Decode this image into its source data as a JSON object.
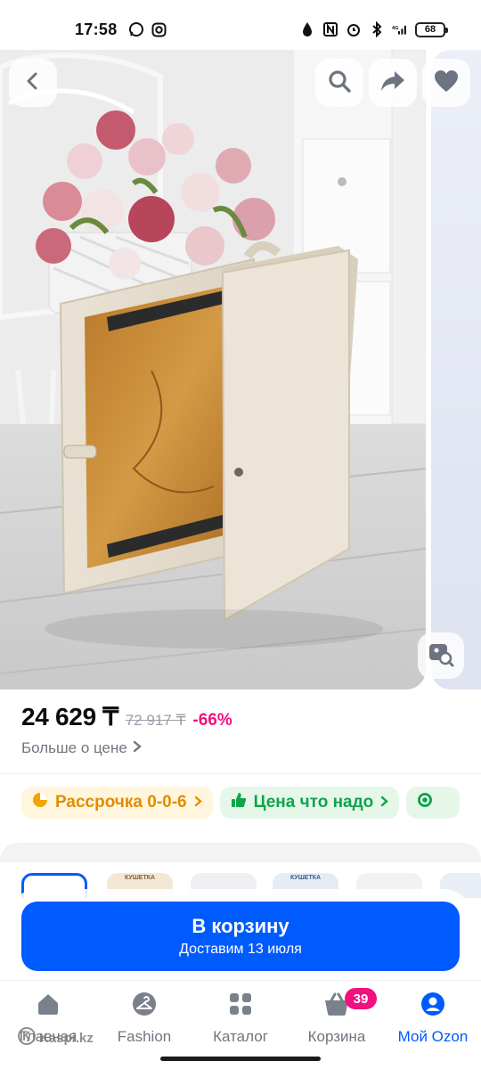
{
  "status_bar": {
    "time": "17:58",
    "battery": "68"
  },
  "gallery": {
    "back_icon": "chevron-left-icon",
    "search_icon": "search-icon",
    "share_icon": "share-arrow-icon",
    "favorite_icon": "heart-icon",
    "lens_icon": "image-search-icon"
  },
  "price": {
    "current": "24 629 ₸",
    "old": "72 917 ₸",
    "discount": "-66%",
    "more_label": "Больше о цене"
  },
  "chips": [
    {
      "label": "Рассрочка 0-0-6",
      "icon": "pie-icon"
    },
    {
      "label": "Цена что надо",
      "icon": "thumbs-up-icon"
    },
    {
      "label": "",
      "icon": "ruble-circle-icon"
    }
  ],
  "thumbnails": [
    {
      "label": ""
    },
    {
      "label": "КУШЕТКА"
    },
    {
      "label": ""
    },
    {
      "label": "КУШЕТКА"
    },
    {
      "label": ""
    },
    {
      "label": ""
    }
  ],
  "cart": {
    "title": "В корзину",
    "subtitle": "Доставим 13 июля"
  },
  "nav": {
    "home": "Главная",
    "fashion": "Fashion",
    "catalog": "Каталог",
    "cart": "Корзина",
    "cart_badge": "39",
    "profile": "Мой Ozon"
  },
  "watermark": "Kaspi.kz",
  "colors": {
    "accent": "#005bff",
    "discount": "#f1117e",
    "installment": "#e08d00",
    "good_price": "#0fa44a"
  }
}
